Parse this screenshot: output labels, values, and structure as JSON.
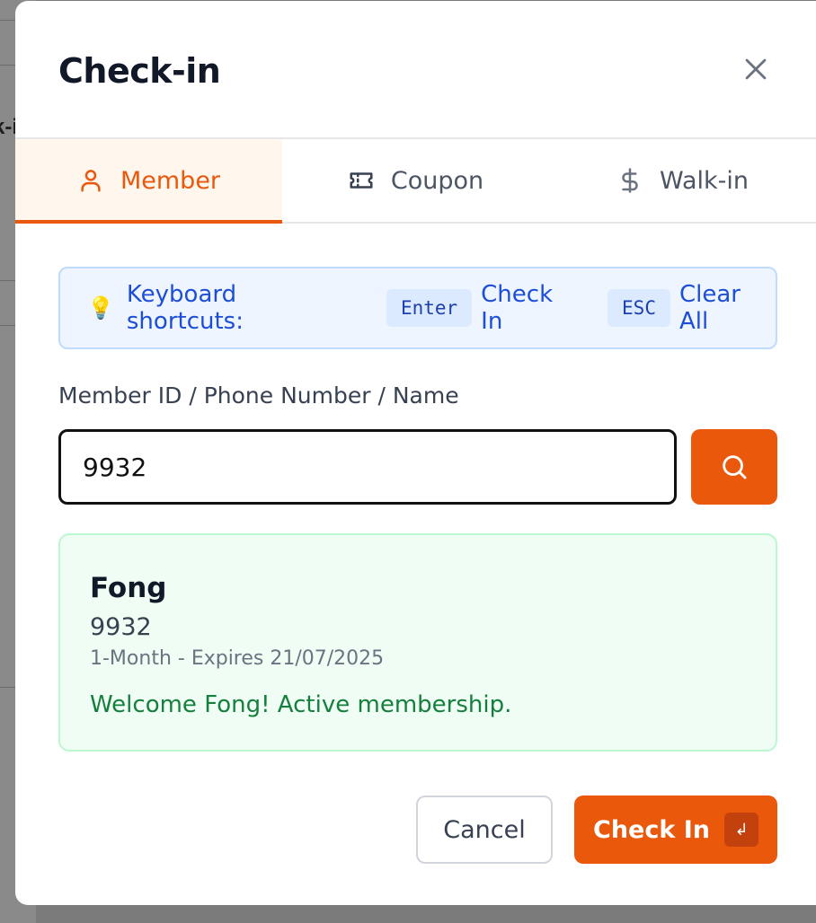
{
  "background": {
    "fragment_text": "k-i"
  },
  "modal": {
    "title": "Check-in",
    "close_icon": "close-icon"
  },
  "tabs": [
    {
      "label": "Member",
      "icon": "user-icon",
      "active": true
    },
    {
      "label": "Coupon",
      "icon": "ticket-icon",
      "active": false
    },
    {
      "label": "Walk-in",
      "icon": "dollar-icon",
      "active": false
    }
  ],
  "shortcuts": {
    "icon": "lightbulb-icon",
    "label": "Keyboard shortcuts:",
    "items": [
      {
        "key": "Enter",
        "action": "Check In"
      },
      {
        "key": "ESC",
        "action": "Clear All"
      }
    ]
  },
  "search": {
    "label": "Member ID / Phone Number / Name",
    "value": "9932",
    "button_icon": "search-icon"
  },
  "result": {
    "name": "Fong",
    "id": "9932",
    "plan": "1-Month - Expires 21/07/2025",
    "message": "Welcome Fong! Active membership."
  },
  "footer": {
    "cancel_label": "Cancel",
    "checkin_label": "Check In",
    "enter_badge": "↲"
  },
  "colors": {
    "accent": "#ea580c",
    "info_bg": "#eef5ff",
    "success_bg": "#f0fdf4",
    "success_text": "#15803d"
  }
}
